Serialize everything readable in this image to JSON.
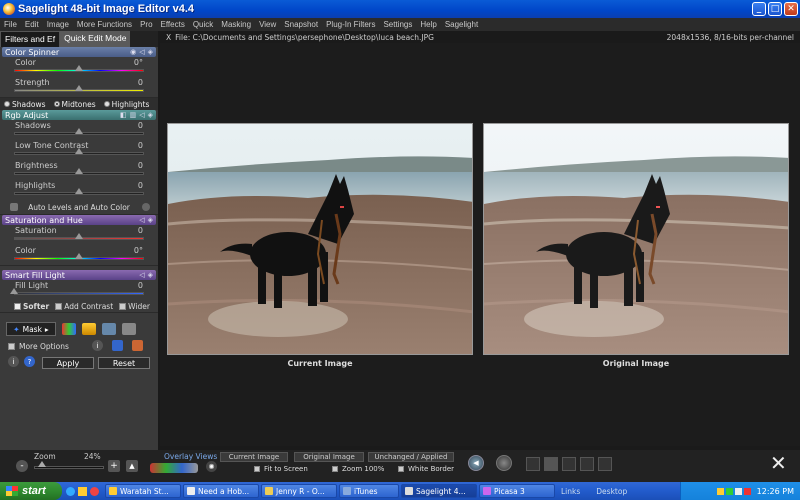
{
  "window": {
    "title": "Sagelight 48-bit Image Editor v4.4",
    "buttons": {
      "minimize": "_",
      "maximize": "□",
      "close": "✕"
    }
  },
  "menu": [
    "File",
    "Edit",
    "Image",
    "More Functions",
    "Pro",
    "Effects",
    "Quick",
    "Masking",
    "View",
    "Snapshot",
    "Plug-In Filters",
    "Settings",
    "Help",
    "Sagelight"
  ],
  "tabs": {
    "filters": "Filters and Ef",
    "quick_edit": "Quick Edit Mode"
  },
  "color_spinner": {
    "title": "Color Spinner",
    "color_label": "Color",
    "color_value": "0°",
    "strength_label": "Strength",
    "strength_value": "0"
  },
  "tone_radios": {
    "shadows": "Shadows",
    "midtones": "Midtones",
    "highlights": "Highlights",
    "selected": "midtones"
  },
  "rgb_adjust": {
    "title": "Rgb Adjust",
    "sliders": [
      {
        "label": "Shadows",
        "value": "0"
      },
      {
        "label": "Low Tone Contrast",
        "value": "0"
      },
      {
        "label": "Brightness",
        "value": "0"
      },
      {
        "label": "Highlights",
        "value": "0"
      }
    ],
    "auto_label": "Auto Levels and Auto Color"
  },
  "saturation_hue": {
    "title": "Saturation and Hue",
    "saturation_label": "Saturation",
    "saturation_value": "0",
    "color_label": "Color",
    "color_value": "0°"
  },
  "smart_fill": {
    "title": "Smart Fill Light",
    "fill_label": "Fill Light",
    "fill_value": "0",
    "softer": "Softer",
    "add_contrast": "Add Contrast",
    "wider": "Wider"
  },
  "tools": {
    "mask_label": "Mask"
  },
  "footer": {
    "more_options": "More Options",
    "apply": "Apply",
    "reset": "Reset",
    "info_icon": "i",
    "help_icon": "?"
  },
  "file": {
    "path": "File: C:\\Documents and Settings\\persephone\\Desktop\\luca beach.JPG",
    "info": "2048x1536, 8/16-bits per-channel",
    "close_x": "X"
  },
  "captions": {
    "current": "Current Image",
    "original": "Original Image"
  },
  "zoom": {
    "label": "Zoom",
    "value": "24%",
    "minus": "-",
    "plus": "+"
  },
  "overlay": {
    "label": "Overlay Views",
    "tabs": [
      "Current Image",
      "Original Image",
      "Unchanged / Applied"
    ],
    "fit": "Fit to Screen",
    "zoom100": "Zoom 100%",
    "white_border": "White Border"
  },
  "taskbar": {
    "start": "start",
    "items": [
      "Waratah St...",
      "Need a Hob...",
      "Jenny R - O...",
      "iTunes",
      "Sagelight 4...",
      "Picasa 3"
    ],
    "active_index": 4,
    "links": "Links",
    "desktop": "Desktop",
    "clock": "12:26 PM"
  }
}
